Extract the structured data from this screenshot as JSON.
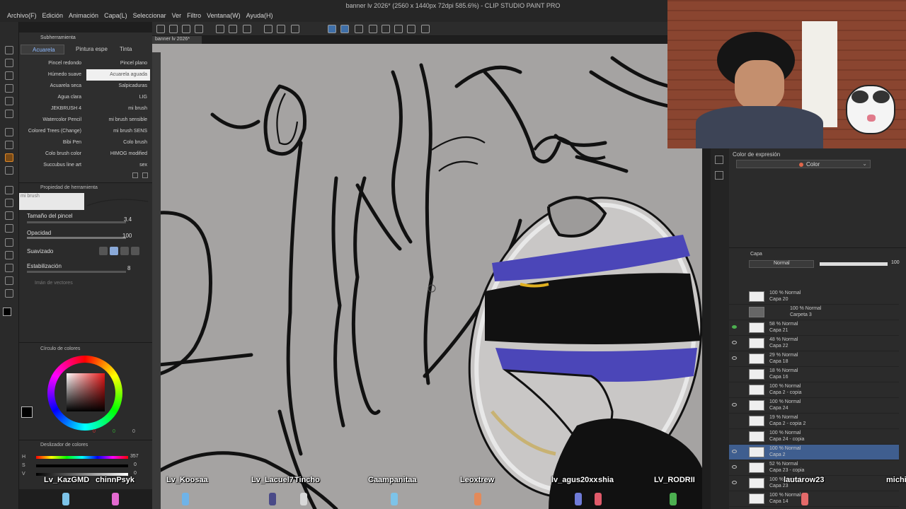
{
  "window": {
    "title": "banner lv 2026* (2560 x 1440px 72dpi 585.6%) - CLIP STUDIO PAINT PRO"
  },
  "menu": [
    "Archivo(F)",
    "Edición",
    "Animación",
    "Capa(L)",
    "Seleccionar",
    "Ver",
    "Filtro",
    "Ventana(W)",
    "Ayuda(H)"
  ],
  "document_tab": "banner lv 2026*",
  "ruler_ticks": [
    "1920",
    "1930",
    "1940",
    "1950",
    "1960",
    "1970",
    "1980",
    "1990",
    "2000",
    "2010",
    "2020",
    "2030",
    "2040",
    "2050",
    "2060",
    "2070",
    "2080",
    "209"
  ],
  "subtool": {
    "panel_title": "Subherramienta",
    "tabs": [
      "Acuarela",
      "Pintura espe",
      "Tinta"
    ],
    "brushes_left": [
      "Pincel redondo",
      "Húmedo suave",
      "Acuarela seca",
      "Agua clara",
      "JEKBRUSH 4",
      "Watercolor Pencil",
      "Colored Trees (Change)",
      "Bibi Pen",
      "Colo brush color",
      "Succubus line art"
    ],
    "brushes_right": [
      "Pincel plano",
      "Acuarela aguada",
      "Salpicaduras",
      "LIG",
      "mi brush",
      "mi brush sensible",
      "mi brush SENS",
      "Colo brush",
      "HIMOG modified",
      "sex"
    ]
  },
  "tool_property": {
    "title": "Propiedad de herramienta",
    "brush_name": "mi brush",
    "size_label": "Tamaño del pincel",
    "size_value": "3.4",
    "opacity_label": "Opacidad",
    "opacity_value": "100",
    "smoothing_label": "Suavizado",
    "stabilization_label": "Estabilización",
    "stabilization_value": "8",
    "vector_label": "Imán de vectores"
  },
  "color_circle": {
    "title": "Círculo de colores",
    "values": [
      "0",
      "0",
      "0"
    ]
  },
  "color_slider": {
    "title": "Deslizador de colores",
    "h_label": "H",
    "h_value": "357",
    "s_label": "S",
    "s_value": "0",
    "v_label": "V",
    "v_value": "0"
  },
  "expression": {
    "title": "Color de expresión",
    "value": "Color"
  },
  "layers": {
    "tab": "Capa",
    "blend_mode": "Normal",
    "opacity": "100",
    "items": [
      {
        "mode": "100 % Normal",
        "name": "Capa 20"
      },
      {
        "mode": "100 % Normal",
        "name": "Carpeta 3"
      },
      {
        "mode": "58 % Normal",
        "name": "Capa 21"
      },
      {
        "mode": "48 % Normal",
        "name": "Capa 22"
      },
      {
        "mode": "29 % Normal",
        "name": "Capa 18"
      },
      {
        "mode": "18 % Normal",
        "name": "Capa 16"
      },
      {
        "mode": "100 % Normal",
        "name": "Capa 2 - copia"
      },
      {
        "mode": "100 % Normal",
        "name": "Capa 24"
      },
      {
        "mode": "19 % Normal",
        "name": "Capa 2 - copia 2"
      },
      {
        "mode": "100 % Normal",
        "name": "Capa 24 - copia"
      },
      {
        "mode": "100 % Normal",
        "name": "Capa 2"
      },
      {
        "mode": "52 % Normal",
        "name": "Capa 23 - copia"
      },
      {
        "mode": "100 % Normal",
        "name": "Capa 23"
      },
      {
        "mode": "100 % Normal",
        "name": "Capa 14"
      }
    ]
  },
  "viewers": [
    "Lv_KazGMD",
    "chinnPsyk",
    "Lv_Koosaa",
    "Lv_Lacuel7",
    "Tincho",
    "Caampanitaa",
    "Leoxtrew",
    "lv_agus20xx",
    "shia",
    "LV_RODRII",
    "lautarow23",
    "michi"
  ],
  "colors": {
    "accent": "#3f6fa8",
    "ink": "#111111",
    "blue": "#4b46b8",
    "canvas": "#a5a3a2"
  }
}
